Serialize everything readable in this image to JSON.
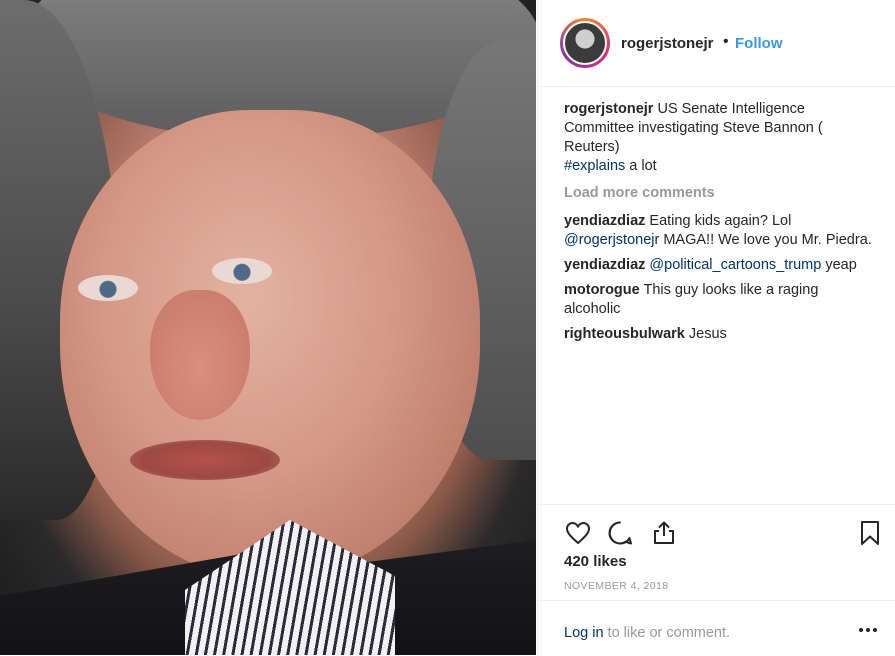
{
  "post": {
    "username": "rogerjstonejr",
    "separator": "•",
    "follow_label": "Follow",
    "caption": {
      "username": "rogerjstonejr",
      "text": "US Senate Intelligence Committee investigating Steve Bannon ( Reuters)",
      "hashtag": "#explains",
      "text_after": "a lot"
    },
    "load_more_label": "Load more comments",
    "comments": [
      {
        "username": "yendiazdiaz",
        "text_before": "Eating kids again? Lol",
        "mention": "@rogerjstonejr",
        "text_after": "MAGA!! We love you Mr. Piedra."
      },
      {
        "username": "yendiazdiaz",
        "text_before": "",
        "mention": "@political_cartoons_trump",
        "text_after": "yeap"
      },
      {
        "username": "motorogue",
        "text_before": "This guy looks like a raging alcoholic",
        "mention": "",
        "text_after": ""
      },
      {
        "username": "righteousbulwark",
        "text_before": "Jesus",
        "mention": "",
        "text_after": ""
      }
    ],
    "likes": "420 likes",
    "date": "NOVEMBER 4, 2018",
    "login_link": "Log in",
    "login_text": "to like or comment.",
    "icons": {
      "like": "heart-icon",
      "comment": "comment-icon",
      "share": "share-icon",
      "save": "bookmark-icon",
      "more": "more-options-icon"
    },
    "colors": {
      "link": "#003569",
      "follow": "#3897f0",
      "muted": "#999999",
      "text": "#262626"
    }
  }
}
